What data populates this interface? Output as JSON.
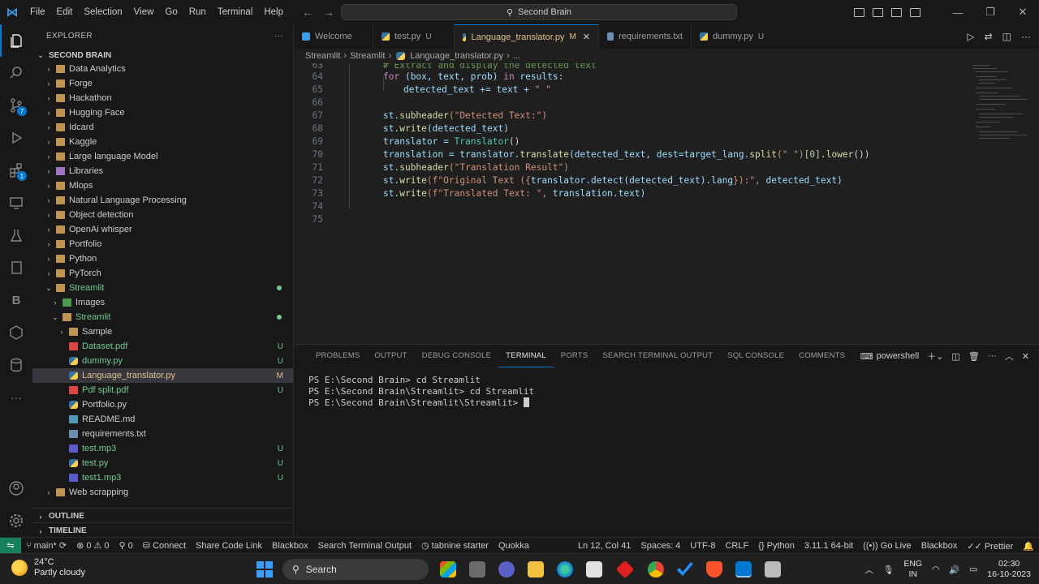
{
  "titlebar": {
    "menu": [
      "File",
      "Edit",
      "Selection",
      "View",
      "Go",
      "Run",
      "Terminal",
      "Help"
    ],
    "command_center": "Second Brain"
  },
  "explorer": {
    "header": "EXPLORER",
    "root": "SECOND BRAIN",
    "items": [
      {
        "label": "Data Analytics"
      },
      {
        "label": "Forge"
      },
      {
        "label": "Hackathon"
      },
      {
        "label": "Hugging Face"
      },
      {
        "label": "Idcard"
      },
      {
        "label": "Kaggle"
      },
      {
        "label": "Large language Model"
      },
      {
        "label": "Libraries"
      },
      {
        "label": "Mlops"
      },
      {
        "label": "Natural Language Processing"
      },
      {
        "label": "Object detection"
      },
      {
        "label": "OpenAi whisper"
      },
      {
        "label": "Portfolio"
      },
      {
        "label": "Python"
      },
      {
        "label": "PyTorch"
      },
      {
        "label": "Streamlit"
      },
      {
        "label": "Images"
      },
      {
        "label": "Streamlit"
      },
      {
        "label": "Sample"
      },
      {
        "label": "Dataset.pdf",
        "status": "U"
      },
      {
        "label": "dummy.py",
        "status": "U"
      },
      {
        "label": "Language_translator.py",
        "status": "M"
      },
      {
        "label": "Pdf split.pdf",
        "status": "U"
      },
      {
        "label": "Portfolio.py"
      },
      {
        "label": "README.md"
      },
      {
        "label": "requirements.txt"
      },
      {
        "label": "test.mp3",
        "status": "U"
      },
      {
        "label": "test.py",
        "status": "U"
      },
      {
        "label": "test1.mp3",
        "status": "U"
      },
      {
        "label": "Web scrapping"
      }
    ],
    "outline": "OUTLINE",
    "timeline": "TIMELINE"
  },
  "tabs": [
    {
      "label": "Welcome",
      "flag": ""
    },
    {
      "label": "test.py",
      "flag": "U"
    },
    {
      "label": "Language_translator.py",
      "flag": "M"
    },
    {
      "label": "requirements.txt",
      "flag": ""
    },
    {
      "label": "dummy.py",
      "flag": "U"
    }
  ],
  "breadcrumb": [
    "Streamlit",
    "Streamlit",
    "Language_translator.py",
    "..."
  ],
  "editor": {
    "line_numbers": [
      "63",
      "64",
      "65",
      "66",
      "67",
      "68",
      "69",
      "70",
      "71",
      "72",
      "73",
      "74",
      "75"
    ],
    "lines": {
      "l63": "# Extract and display the detected text",
      "l64_kw": "for",
      "l64_a": " (box, text, prob) ",
      "l64_in": "in",
      "l64_b": " results:",
      "l65_a": "detected_text += text + ",
      "l65_s": "\" \"",
      "l67_a": "st.",
      "l67_f": "subheader",
      "l67_s": "(\"Detected Text:\")",
      "l68_a": "st.",
      "l68_f": "write",
      "l68_b": "(detected_text)",
      "l69_a": "translator = ",
      "l69_c": "Translator",
      "l69_b": "()",
      "l70_a": "translation = translator.",
      "l70_f": "translate",
      "l70_b": "(detected_text, dest=target_lang.",
      "l70_f2": "split",
      "l70_s": "(\" \")",
      "l70_n": "[0]",
      "l70_f3": ".lower",
      "l70_c": "())",
      "l71_a": "st.",
      "l71_f": "subheader",
      "l71_s": "(\"Translation Result\")",
      "l72_a": "st.",
      "l72_f": "write",
      "l72_s": "(f\"Original Text ({",
      "l72_m": "translator.detect(detected_text).lang",
      "l72_s2": "}):\",",
      "l72_b": " detected_text)",
      "l73_a": "st.",
      "l73_f": "write",
      "l73_s": "(f\"Translated Text: \",",
      "l73_b": " translation.text)"
    }
  },
  "panel": {
    "tabs": [
      "PROBLEMS",
      "OUTPUT",
      "DEBUG CONSOLE",
      "TERMINAL",
      "PORTS",
      "SEARCH TERMINAL OUTPUT",
      "SQL CONSOLE",
      "COMMENTS"
    ],
    "active_tab": "TERMINAL",
    "shell": "powershell",
    "terminal_lines": [
      "PS E:\\Second Brain> cd Streamlit",
      "PS E:\\Second Brain\\Streamlit> cd Streamlit",
      "PS E:\\Second Brain\\Streamlit\\Streamlit> "
    ]
  },
  "statusbar": {
    "branch": "main*",
    "problems": "⊗ 0 ⚠ 0",
    "ports": "⚲ 0",
    "left_items": [
      "Connect",
      "Share Code Link",
      "Blackbox",
      "Search Terminal Output",
      "tabnine starter",
      "Quokka"
    ],
    "right_items": [
      "Ln 12, Col 41",
      "Spaces: 4",
      "UTF-8",
      "CRLF",
      "Python",
      "3.11.1 64-bit",
      "Go Live",
      "Blackbox",
      "Prettier"
    ]
  },
  "taskbar": {
    "temperature": "24°C",
    "weather": "Partly cloudy",
    "search": "Search",
    "lang_top": "ENG",
    "lang_bottom": "IN",
    "time": "02:30",
    "date": "16-10-2023"
  },
  "colors": {
    "accent": "#0078d4",
    "status_remote": "#16825d",
    "git_untracked": "#73c991",
    "git_modified": "#e2c08d"
  }
}
